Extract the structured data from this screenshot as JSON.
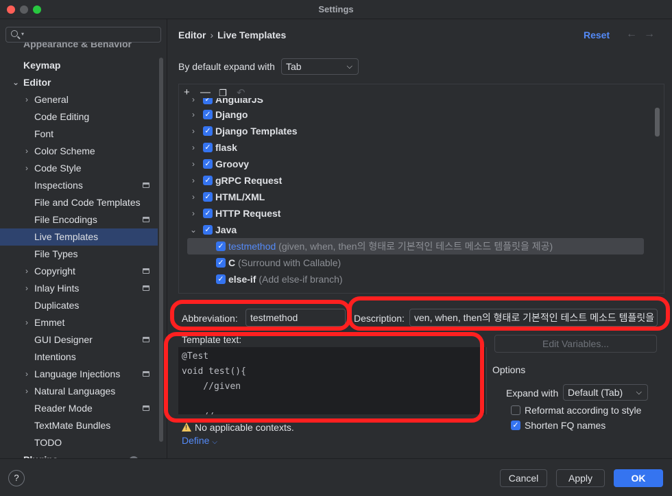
{
  "window": {
    "title": "Settings"
  },
  "sidebar": {
    "search_placeholder": "",
    "items": [
      {
        "label": "Appearance & Behavior",
        "level": 0,
        "bold": true
      },
      {
        "label": "Keymap",
        "level": 0,
        "bold": true
      },
      {
        "label": "Editor",
        "level": 0,
        "bold": true,
        "expanded": true
      },
      {
        "label": "General",
        "level": 1,
        "chevron": true
      },
      {
        "label": "Code Editing",
        "level": 1
      },
      {
        "label": "Font",
        "level": 1
      },
      {
        "label": "Color Scheme",
        "level": 1,
        "chevron": true
      },
      {
        "label": "Code Style",
        "level": 1,
        "chevron": true
      },
      {
        "label": "Inspections",
        "level": 1,
        "project": true
      },
      {
        "label": "File and Code Templates",
        "level": 1
      },
      {
        "label": "File Encodings",
        "level": 1,
        "project": true
      },
      {
        "label": "Live Templates",
        "level": 1,
        "selected": true
      },
      {
        "label": "File Types",
        "level": 1
      },
      {
        "label": "Copyright",
        "level": 1,
        "chevron": true,
        "project": true
      },
      {
        "label": "Inlay Hints",
        "level": 1,
        "chevron": true,
        "project": true
      },
      {
        "label": "Duplicates",
        "level": 1
      },
      {
        "label": "Emmet",
        "level": 1,
        "chevron": true
      },
      {
        "label": "GUI Designer",
        "level": 1,
        "project": true
      },
      {
        "label": "Intentions",
        "level": 1
      },
      {
        "label": "Language Injections",
        "level": 1,
        "chevron": true,
        "project": true
      },
      {
        "label": "Natural Languages",
        "level": 1,
        "chevron": true
      },
      {
        "label": "Reader Mode",
        "level": 1,
        "project": true
      },
      {
        "label": "TextMate Bundles",
        "level": 1
      },
      {
        "label": "TODO",
        "level": 1
      },
      {
        "label": "Plugins",
        "level": 0,
        "bold": true
      }
    ]
  },
  "header": {
    "breadcrumb_parent": "Editor",
    "breadcrumb_sep": "›",
    "breadcrumb_current": "Live Templates",
    "reset_label": "Reset"
  },
  "expand_default": {
    "label": "By default expand with",
    "value": "Tab"
  },
  "templates": {
    "groups": [
      {
        "name": "AngularJS",
        "checked": true
      },
      {
        "name": "Django",
        "checked": true
      },
      {
        "name": "Django Templates",
        "checked": true
      },
      {
        "name": "flask",
        "checked": true
      },
      {
        "name": "Groovy",
        "checked": true
      },
      {
        "name": "gRPC Request",
        "checked": true
      },
      {
        "name": "HTML/XML",
        "checked": true
      },
      {
        "name": "HTTP Request",
        "checked": true
      },
      {
        "name": "Java",
        "checked": true,
        "expanded": true
      }
    ],
    "children": [
      {
        "abbr": "testmethod",
        "desc": "(given, when, then의 형태로 기본적인 테스트 메소드 템플릿을 제공)",
        "checked": true,
        "selected": true
      },
      {
        "abbr": "C",
        "desc": "(Surround with Callable)",
        "checked": true
      },
      {
        "abbr": "else-if",
        "desc": "(Add else-if branch)",
        "checked": true
      }
    ]
  },
  "form": {
    "abbreviation_label": "Abbreviation:",
    "abbreviation_value": "testmethod",
    "description_label": "Description:",
    "description_value": "ven, when, then의 형태로 기본적인 테스트 메소드 템플릿을 제공",
    "template_text_label": "Template text:",
    "template_lines": [
      "@Test",
      "void test(){",
      "    //given",
      "",
      "    // ·"
    ],
    "edit_variables_label": "Edit Variables..."
  },
  "options": {
    "title": "Options",
    "expand_with_label": "Expand with",
    "expand_with_value": "Default (Tab)",
    "reformat_label": "Reformat according to style",
    "reformat_checked": false,
    "shorten_label": "Shorten FQ names",
    "shorten_checked": true
  },
  "context": {
    "warning": "No applicable contexts.",
    "define_label": "Define"
  },
  "footer": {
    "help": "?",
    "cancel": "Cancel",
    "apply": "Apply",
    "ok": "OK"
  },
  "colors": {
    "accent": "#3574f0",
    "link": "#548af7",
    "highlight": "#ff2020"
  }
}
